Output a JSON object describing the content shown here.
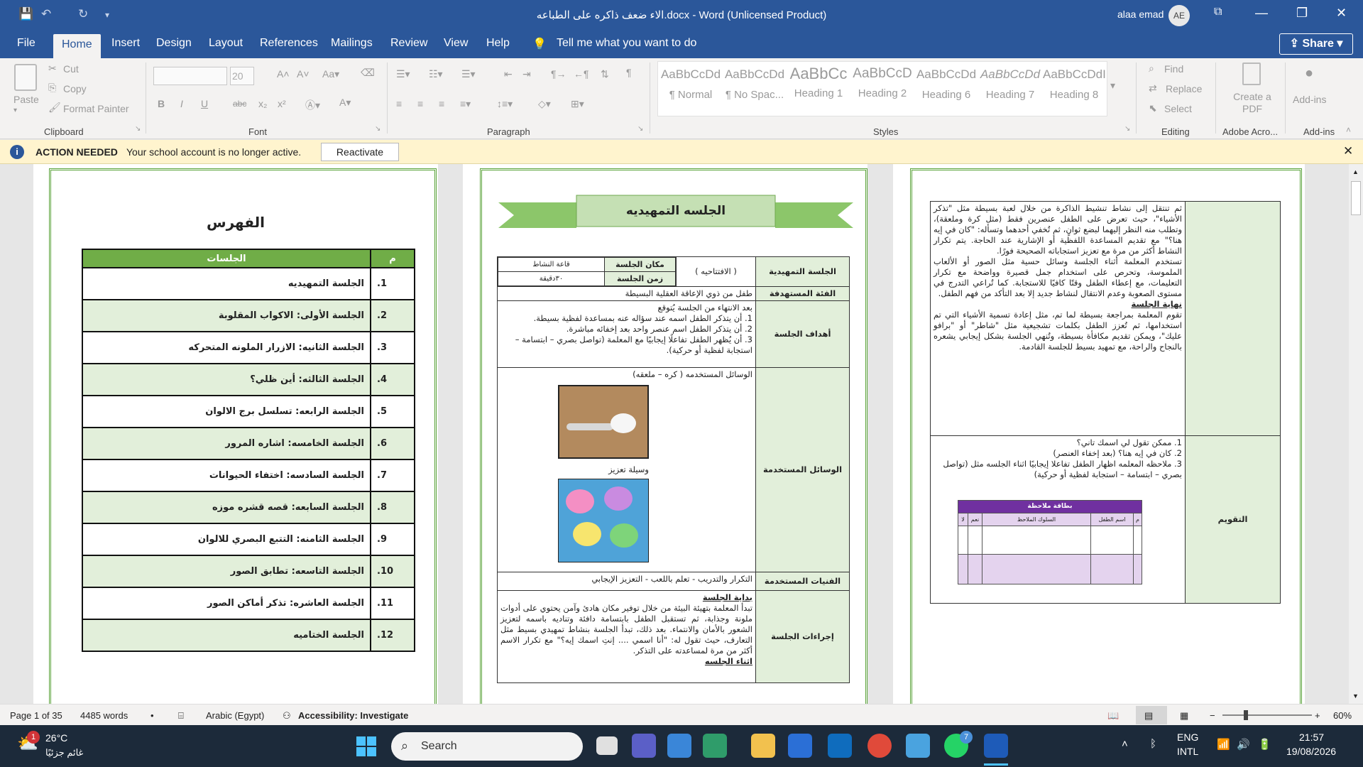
{
  "titlebar": {
    "title": "الاء ضعف ذاكره على الطباعه.docx  -  Word (Unlicensed Product)",
    "user": "alaa emad",
    "initials": "AE",
    "save": "💾",
    "undo": "↶",
    "redo": "↻",
    "customize": "▾"
  },
  "tabs": [
    "File",
    "Home",
    "Insert",
    "Design",
    "Layout",
    "References",
    "Mailings",
    "Review",
    "View",
    "Help"
  ],
  "tell_me": "Tell me what you want to do",
  "share": "Share",
  "ribbon": {
    "clipboard": {
      "paste": "Paste",
      "cut": "Cut",
      "copy": "Copy",
      "format_painter": "Format Painter",
      "label": "Clipboard"
    },
    "font": {
      "label": "Font",
      "size": "20",
      "bold": "B",
      "italic": "I",
      "underline": "U",
      "strike": "abc",
      "sub": "x₂",
      "sup": "x²"
    },
    "paragraph": {
      "label": "Paragraph"
    },
    "styles": {
      "label": "Styles",
      "items": [
        {
          "preview": "AaBbCcDd",
          "name": "¶ Normal"
        },
        {
          "preview": "AaBbCcDd",
          "name": "¶ No Spac..."
        },
        {
          "preview": "AaBbCc",
          "name": "Heading 1"
        },
        {
          "preview": "AaBbCcD",
          "name": "Heading 2"
        },
        {
          "preview": "AaBbCcDd",
          "name": "Heading 6"
        },
        {
          "preview": "AaBbCcDd",
          "name": "Heading 7"
        },
        {
          "preview": "AaBbCcDdI",
          "name": "Heading 8"
        }
      ]
    },
    "editing": {
      "label": "Editing",
      "find": "Find",
      "replace": "Replace",
      "select": "Select"
    },
    "adobe": {
      "label": "Adobe Acro...",
      "create": "Create a PDF"
    },
    "addins": {
      "label": "Add-ins",
      "text": "Add-ins"
    }
  },
  "notice": {
    "title": "ACTION NEEDED",
    "message": "Your school account is no longer active.",
    "button": "Reactivate"
  },
  "page1": {
    "title": "الفهرس",
    "col_num": "م",
    "col_name": "الجلسات",
    "rows": [
      {
        "n": "1.",
        "t": "الجلسة التمهيديه"
      },
      {
        "n": "2.",
        "t": "الجلسة الأولى: الاكواب المقلوبة"
      },
      {
        "n": "3.",
        "t": "الجلسة الثانيه:  الازرار الملونه المتحركه"
      },
      {
        "n": "4.",
        "t": "الجلسة الثالثه: أين ظلي؟"
      },
      {
        "n": "5.",
        "t": "الجلسة الرابعه:   تسلسل برج الالوان"
      },
      {
        "n": "6.",
        "t": "الجلسة الخامسه:  اشاره المرور"
      },
      {
        "n": "7.",
        "t": "الجلسة السادسه:  اختفاء الحيوانات"
      },
      {
        "n": "8.",
        "t": "الجلسة السابعه:  قصه قشره موزه"
      },
      {
        "n": "9.",
        "t": "الجلسة الثامنه:  التتبع البصري للالوان"
      },
      {
        "n": "10.",
        "t": "الجلسة التاسعه:  تطابق الصور"
      },
      {
        "n": "11.",
        "t": "الجلسة العاشره: تذكر أماكن الصور"
      },
      {
        "n": "12.",
        "t": "الجلسة الختاميه"
      }
    ]
  },
  "page2": {
    "banner": "الجلسه التمهيديه",
    "session_label": "الجلسة التمهيدية",
    "session_value": "( الافتتاحيه )",
    "place_label": "مكان الجلسة",
    "place_value": "قاعة النشاط",
    "time_label": "زمن الجلسة",
    "time_value": "٣٠دقيقة",
    "target_label": "الفئة المستهدفة",
    "target_value": "طفل من ذوي الإعاقة العقلية البسيطة",
    "goals_label": "أهداف الجلسة",
    "goals_intro": "بعد الانتهاء من الجلسة يُتوقع",
    "goals": [
      "1. أن يتذكر الطفل اسمه عند سؤاله عنه بمساعدة لفظية بسيطة.",
      "2. أن يتذكر الطفل اسم عنصر واحد بعد إخفائه مباشرة.",
      "3. أن يُظهر الطفل تفاعلًا إيجابيًا مع المعلمة (تواصل بصري – ابتسامة – استجابة لفظية أو حركية)."
    ],
    "tools_label": "الوسائل المستخدمة",
    "tools_intro": "الوسائل المستخدمه ( كره – ملعقه)",
    "tools_caption": "وسيلة تعزيز",
    "tech_label": "الفنيات المستخدمة",
    "tech_value": "التكرار والتدريب - تعلم باللعب - التعزيز الإيجابي",
    "proc_label": "إجراءات الجلسة",
    "proc_head": "بداية الجلسة",
    "proc_text": "تبدأ المعلمة بتهيئة البيئة من خلال توفير مكان هادئ وآمن يحتوي على أدوات ملونة وجذابة، ثم تستقبل الطفل بابتسامة دافئة وتناديه باسمه لتعزيز الشعور بالأمان والانتماء. بعد ذلك، تبدأ الجلسة بنشاط تمهيدي بسيط مثل التعارف، حيث تقول له: \"أنا اسمي .... إنتِ اسمك إيه؟\" مع تكرار الاسم أكثر من مرة لمساعدته على التذكر.",
    "proc_tail": "اثناء الجلسه"
  },
  "page3": {
    "text1": "ثم تنتقل إلى نشاط تنشيط الذاكرة من خلال لعبة بسيطة مثل \"تذكر الأشياء\"، حيث تعرض على الطفل عنصرين فقط (مثل كرة وملعقة)، وتطلب منه النظر إليهما لبضع ثوانٍ، ثم تُخفي أحدهما وتسأله: \"كان في إيه هنا؟\" مع تقديم المساعدة اللفظية أو الإشارية عند الحاجة. يتم تكرار النشاط أكثر من مرة مع تعزيز استجاباته الصحيحة فورًا.",
    "text2": "تستخدم المعلمة أثناء الجلسة وسائل حسية مثل الصور أو الألعاب الملموسة، وتحرص على استخدام جمل قصيرة وواضحة مع تكرار التعليمات، مع إعطاء الطفل وقتًا كافيًا للاستجابة. كما تُراعي التدرج في مستوى الصعوبة وعدم الانتقال لنشاط جديد إلا بعد التأكد من فهم الطفل.",
    "end_head": "نهاية الجلسة",
    "text3": "تقوم المعلمة بمراجعة بسيطة لما تم، مثل إعادة تسمية الأشياء التي تم استخدامها، ثم تُعزز الطفل بكلمات تشجيعية مثل \"شاطر\" أو \"برافو عليك\"، ويمكن تقديم مكافأة بسيطة، وتُنهي الجلسة بشكل إيجابي يشعره بالنجاح والراحة، مع تمهيد بسيط للجلسة القادمة.",
    "eval_label": "التقويم",
    "eval_items": [
      "1. ممكن تقول لي اسمك تاني؟",
      "2. كان في إيه هنا؟ (بعد إخفاء العنصر)",
      "3. ملاحظه المعلمه اظهار الطفل تفاعلا إيجابيًا اثناء الجلسه مثل (تواصل بصري – ابتسامة – استجابة لفظية أو حركية)"
    ],
    "card_title": "بطاقة ملاحظة",
    "card_cols": [
      "م",
      "اسم الطفل",
      "السلوك الملاحظ",
      "نعم",
      "لا"
    ]
  },
  "status": {
    "page": "Page 1 of 35",
    "words": "4485 words",
    "lang": "Arabic (Egypt)",
    "access": "Accessibility: Investigate",
    "zoom": "60%"
  },
  "taskbar": {
    "temp": "26°C",
    "weather": "غائم جزئيًا",
    "search": "Search",
    "lang1": "ENG",
    "lang2": "INTL",
    "time": "21:57",
    "date": "19/08/2026",
    "badge": "1",
    "wa_badge": "7"
  }
}
